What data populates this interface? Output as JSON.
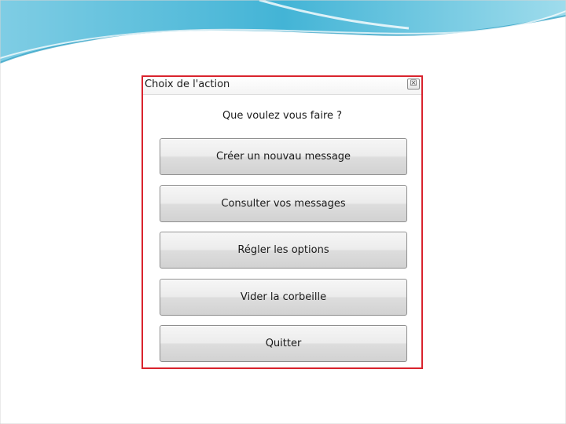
{
  "dialog": {
    "title": "Choix de l'action",
    "close_glyph": "☒",
    "prompt": "Que voulez vous faire ?",
    "buttons": [
      {
        "label": "Créer un nouvau message"
      },
      {
        "label": "Consulter vos messages"
      },
      {
        "label": "Régler les options"
      },
      {
        "label": "Vider la corbeille"
      },
      {
        "label": "Quitter"
      }
    ]
  },
  "colors": {
    "highlight_border": "#d9232d",
    "banner_blue": "#4fb8d8"
  }
}
